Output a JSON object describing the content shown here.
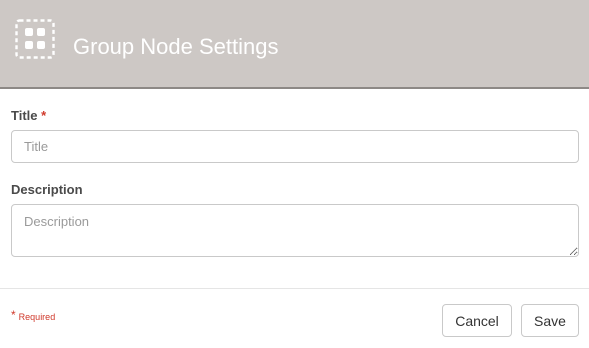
{
  "header": {
    "title": "Group Node Settings",
    "icon": "group-node-icon"
  },
  "form": {
    "title_label": "Title",
    "required_marker": "*",
    "title_placeholder": "Title",
    "title_value": "",
    "description_label": "Description",
    "description_placeholder": "Description",
    "description_value": ""
  },
  "footer": {
    "required_star": "*",
    "required_text": "Required",
    "cancel_label": "Cancel",
    "save_label": "Save"
  },
  "colors": {
    "header_bg": "#cdc8c5",
    "header_border": "#8d8986",
    "required": "#d0392b"
  }
}
